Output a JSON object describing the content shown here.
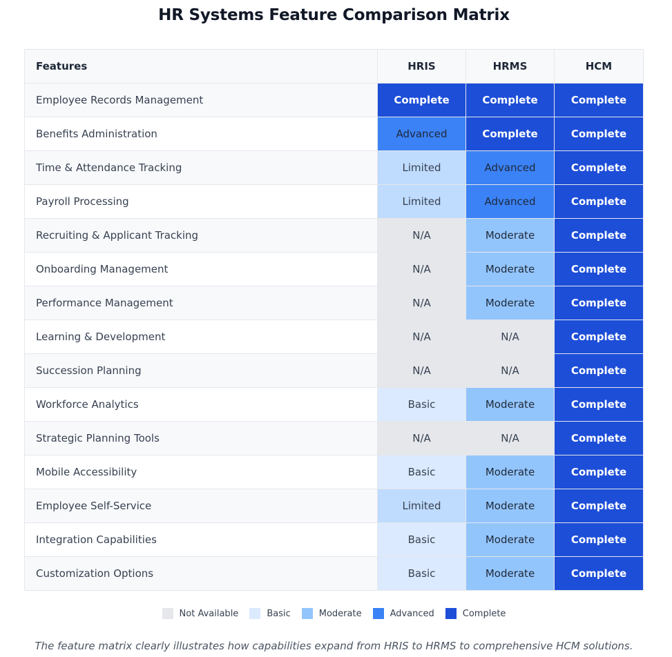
{
  "title": "HR Systems Feature Comparison Matrix",
  "table": {
    "feature_header": "Features",
    "columns": [
      "HRIS",
      "HRMS",
      "HCM"
    ],
    "rows": [
      {
        "feature": "Employee Records Management",
        "values": [
          "Complete",
          "Complete",
          "Complete"
        ],
        "levels": [
          "complete",
          "complete",
          "complete"
        ]
      },
      {
        "feature": "Benefits Administration",
        "values": [
          "Advanced",
          "Complete",
          "Complete"
        ],
        "levels": [
          "advanced",
          "complete",
          "complete"
        ]
      },
      {
        "feature": "Time & Attendance Tracking",
        "values": [
          "Limited",
          "Advanced",
          "Complete"
        ],
        "levels": [
          "limited",
          "advanced",
          "complete"
        ]
      },
      {
        "feature": "Payroll Processing",
        "values": [
          "Limited",
          "Advanced",
          "Complete"
        ],
        "levels": [
          "limited",
          "advanced",
          "complete"
        ]
      },
      {
        "feature": "Recruiting & Applicant Tracking",
        "values": [
          "N/A",
          "Moderate",
          "Complete"
        ],
        "levels": [
          "na",
          "moderate",
          "complete"
        ]
      },
      {
        "feature": "Onboarding Management",
        "values": [
          "N/A",
          "Moderate",
          "Complete"
        ],
        "levels": [
          "na",
          "moderate",
          "complete"
        ]
      },
      {
        "feature": "Performance Management",
        "values": [
          "N/A",
          "Moderate",
          "Complete"
        ],
        "levels": [
          "na",
          "moderate",
          "complete"
        ]
      },
      {
        "feature": "Learning & Development",
        "values": [
          "N/A",
          "N/A",
          "Complete"
        ],
        "levels": [
          "na",
          "na",
          "complete"
        ]
      },
      {
        "feature": "Succession Planning",
        "values": [
          "N/A",
          "N/A",
          "Complete"
        ],
        "levels": [
          "na",
          "na",
          "complete"
        ]
      },
      {
        "feature": "Workforce Analytics",
        "values": [
          "Basic",
          "Moderate",
          "Complete"
        ],
        "levels": [
          "basic",
          "moderate",
          "complete"
        ]
      },
      {
        "feature": "Strategic Planning Tools",
        "values": [
          "N/A",
          "N/A",
          "Complete"
        ],
        "levels": [
          "na",
          "na",
          "complete"
        ]
      },
      {
        "feature": "Mobile Accessibility",
        "values": [
          "Basic",
          "Moderate",
          "Complete"
        ],
        "levels": [
          "basic",
          "moderate",
          "complete"
        ]
      },
      {
        "feature": "Employee Self-Service",
        "values": [
          "Limited",
          "Moderate",
          "Complete"
        ],
        "levels": [
          "limited",
          "moderate",
          "complete"
        ]
      },
      {
        "feature": "Integration Capabilities",
        "values": [
          "Basic",
          "Moderate",
          "Complete"
        ],
        "levels": [
          "basic",
          "moderate",
          "complete"
        ]
      },
      {
        "feature": "Customization Options",
        "values": [
          "Basic",
          "Moderate",
          "Complete"
        ],
        "levels": [
          "basic",
          "moderate",
          "complete"
        ]
      }
    ]
  },
  "legend": [
    {
      "label": "Not Available",
      "color": "#e5e7eb"
    },
    {
      "label": "Basic",
      "color": "#dbeafe"
    },
    {
      "label": "Moderate",
      "color": "#93c5fd"
    },
    {
      "label": "Advanced",
      "color": "#3b82f6"
    },
    {
      "label": "Complete",
      "color": "#1d4ed8"
    }
  ],
  "caption": "The feature matrix clearly illustrates how capabilities expand from HRIS to HRMS to comprehensive HCM solutions."
}
